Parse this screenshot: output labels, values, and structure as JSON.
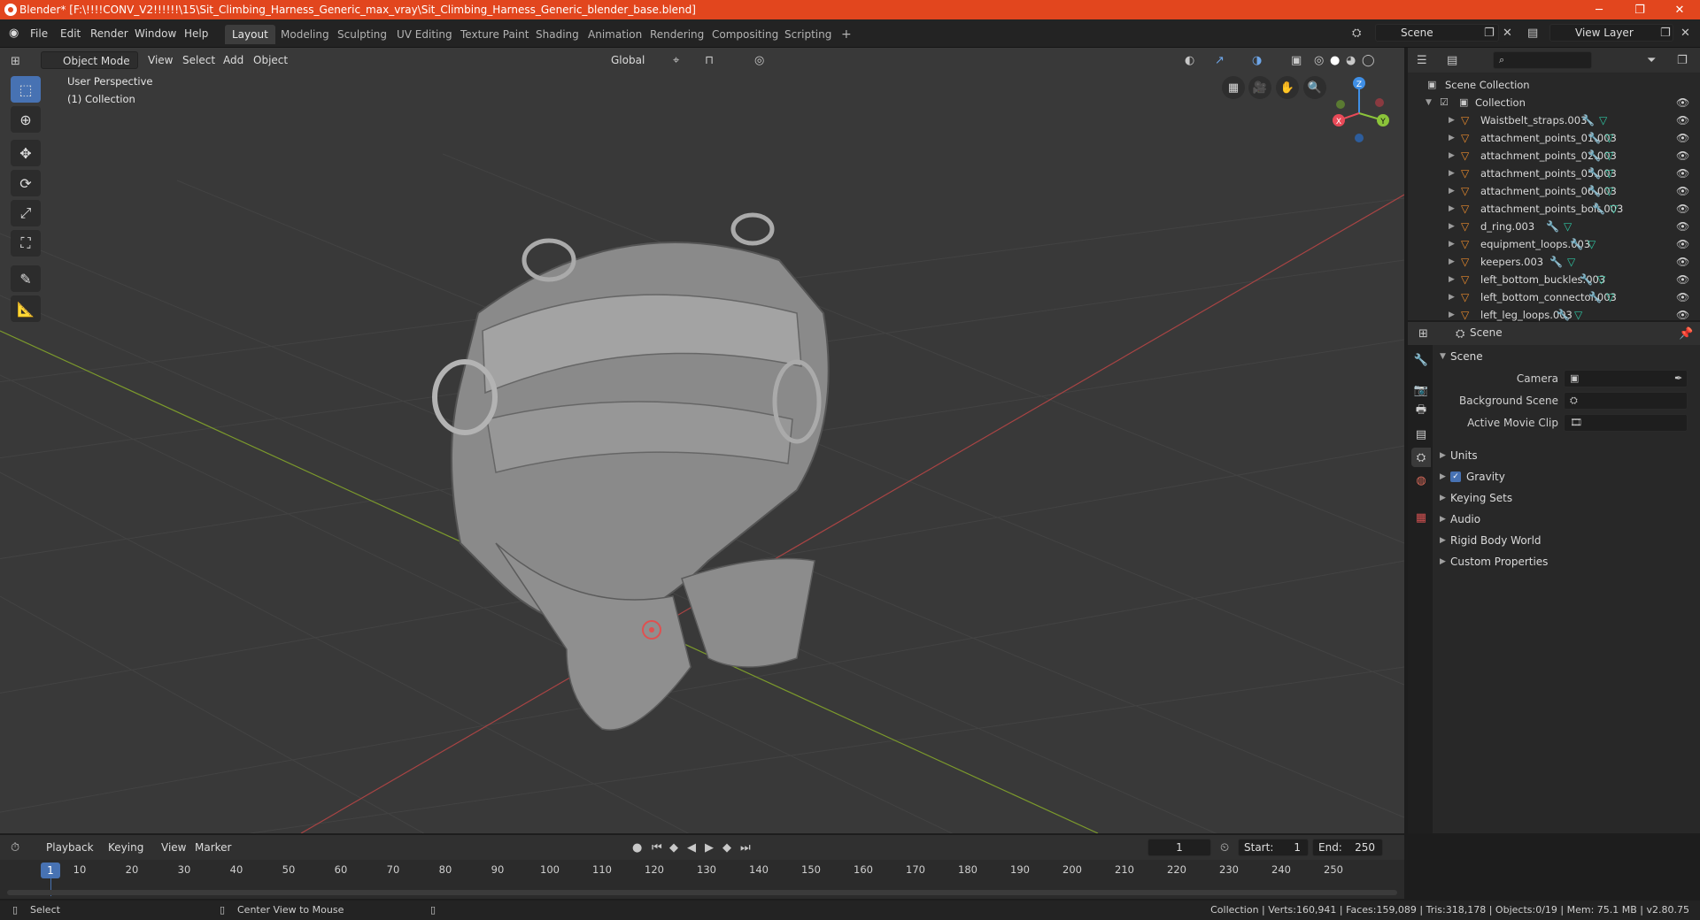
{
  "titlebar": {
    "title": "Blender* [F:\\!!!!CONV_V2!!!!!!\\15\\Sit_Climbing_Harness_Generic_max_vray\\Sit_Climbing_Harness_Generic_blender_base.blend]",
    "minimize": "─",
    "maximize": "❐",
    "close": "✕"
  },
  "menus": [
    "File",
    "Edit",
    "Render",
    "Window",
    "Help"
  ],
  "workspaces": [
    "Layout",
    "Modeling",
    "Sculpting",
    "UV Editing",
    "Texture Paint",
    "Shading",
    "Animation",
    "Rendering",
    "Compositing",
    "Scripting"
  ],
  "add_workspace": "+",
  "scene_field": "Scene",
  "view_layer_field": "View Layer",
  "viewport": {
    "mode": "Object Mode",
    "menus": [
      "View",
      "Select",
      "Add",
      "Object"
    ],
    "transform_orientation": "Global",
    "overlay_title": "User Perspective",
    "overlay_collection": "(1) Collection",
    "gizmo_axes": {
      "x": "X",
      "y": "Y",
      "z": "Z"
    }
  },
  "outliner": {
    "root": "Scene Collection",
    "collection": "Collection",
    "items": [
      "Waistbelt_straps.003",
      "attachment_points_01.003",
      "attachment_points_02.003",
      "attachment_points_05.003",
      "attachment_points_06.003",
      "attachment_points_bolt.003",
      "d_ring.003",
      "equipment_loops.003",
      "keepers.003",
      "left_bottom_buckles.003",
      "left_bottom_connector.003",
      "left_leg_loops.003"
    ]
  },
  "properties": {
    "context": "Scene",
    "panel": "Scene",
    "camera_label": "Camera",
    "background_scene_label": "Background Scene",
    "active_movie_clip_label": "Active Movie Clip",
    "sections": [
      "Units",
      "Gravity",
      "Keying Sets",
      "Audio",
      "Rigid Body World",
      "Custom Properties"
    ],
    "gravity_checked": true
  },
  "timeline": {
    "menus": [
      "Playback",
      "Keying",
      "View",
      "Marker"
    ],
    "current_frame": "1",
    "start_label": "Start:",
    "start": "1",
    "end_label": "End:",
    "end": "250",
    "ruler_current": "1",
    "ruler": [
      "10",
      "20",
      "30",
      "40",
      "50",
      "60",
      "70",
      "80",
      "90",
      "100",
      "110",
      "120",
      "130",
      "140",
      "150",
      "160",
      "170",
      "180",
      "190",
      "200",
      "210",
      "220",
      "230",
      "240",
      "250"
    ]
  },
  "statusbar": {
    "select": "Select",
    "center_view": "Center View to Mouse",
    "stats": "Collection | Verts:160,941 | Faces:159,089 | Tris:318,178 | Objects:0/19 | Mem: 75.1 MB | v2.80.75"
  },
  "colors": {
    "title_bar": "#e2461e",
    "active_tool": "#4772b3",
    "object_icon": "#e98a2c",
    "modifier_icon": "#6ea6e8",
    "mesh_icon": "#2fc6a3",
    "x_axis": "#e94a58",
    "y_axis": "#8bc43a",
    "z_axis": "#3f8fe6"
  }
}
